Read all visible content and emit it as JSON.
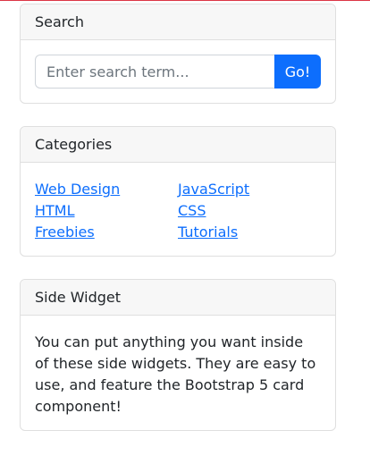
{
  "search": {
    "title": "Search",
    "placeholder": "Enter search term...",
    "button_label": "Go!"
  },
  "categories": {
    "title": "Categories",
    "left_links": [
      "Web Design",
      "HTML",
      "Freebies"
    ],
    "right_links": [
      "JavaScript",
      "CSS",
      "Tutorials"
    ]
  },
  "side_widget": {
    "title": "Side Widget",
    "text": "You can put anything you want inside of these side widgets. They are easy to use, and feature the Bootstrap 5 card component!"
  },
  "colors": {
    "accent": "#0d6efd",
    "header_bg": "#f7f7f7",
    "border": "#dfdfdf",
    "top_line": "#dc3545"
  }
}
